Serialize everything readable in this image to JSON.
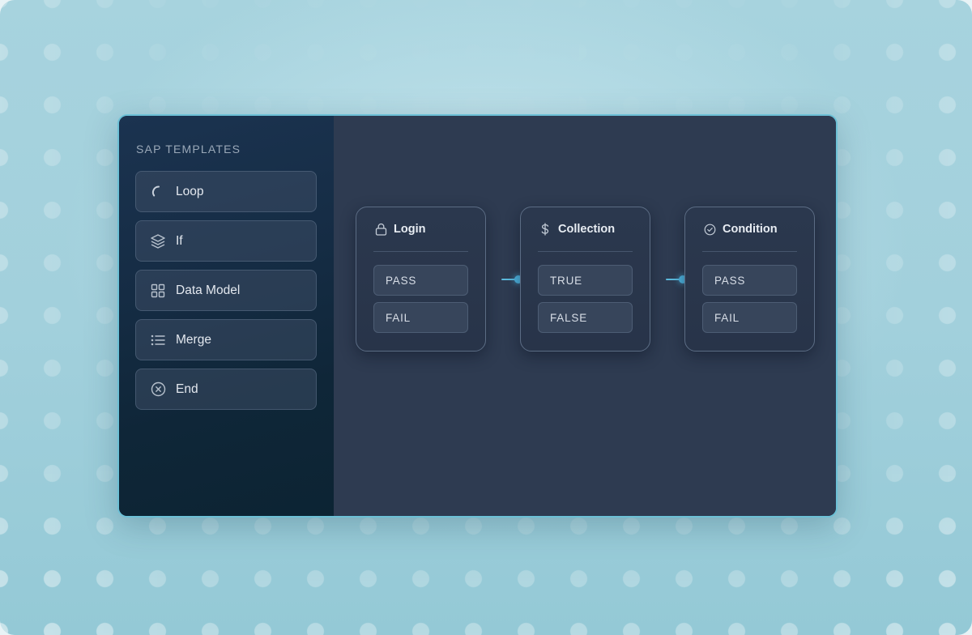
{
  "sidebar": {
    "title": "SAP TEMPLATES",
    "items": [
      {
        "label": "Loop",
        "icon": "loading-arc-icon"
      },
      {
        "label": "If",
        "icon": "layers-icon"
      },
      {
        "label": "Data Model",
        "icon": "grid-icon"
      },
      {
        "label": "Merge",
        "icon": "list-icon"
      },
      {
        "label": "End",
        "icon": "close-circle-icon"
      }
    ]
  },
  "nodes": [
    {
      "title": "Login",
      "icon": "lock-icon",
      "outputs": [
        "PASS",
        "FAIL"
      ]
    },
    {
      "title": "Collection",
      "icon": "dollar-icon",
      "outputs": [
        "TRUE",
        "FALSE"
      ]
    },
    {
      "title": "Condition",
      "icon": "check-circle-icon",
      "outputs": [
        "PASS",
        "FAIL"
      ]
    }
  ],
  "colors": {
    "accent": "#4db3df",
    "canvas": "#2e3b51",
    "sidebar": "#0f2638",
    "frame_border": "#6cc0d6"
  }
}
